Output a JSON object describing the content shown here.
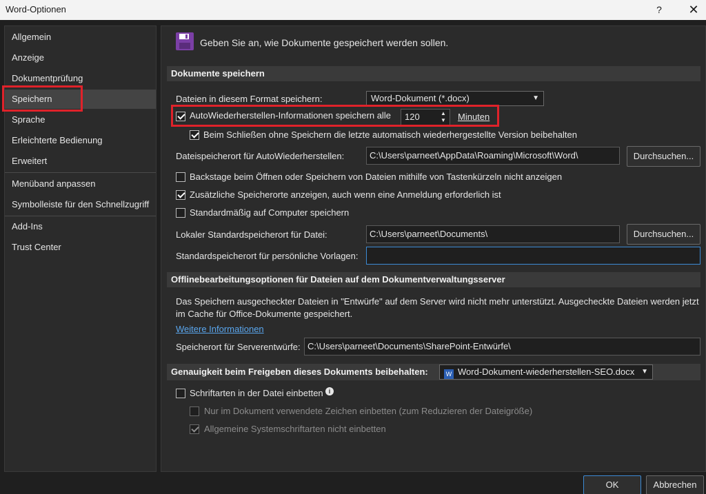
{
  "window": {
    "title": "Word-Optionen",
    "help": "?",
    "close": "✕"
  },
  "sidebar": {
    "items": [
      {
        "label": "Allgemein"
      },
      {
        "label": "Anzeige"
      },
      {
        "label": "Dokumentprüfung"
      },
      {
        "label": "Speichern",
        "selected": true
      },
      {
        "label": "Sprache"
      },
      {
        "label": "Erleichterte Bedienung"
      },
      {
        "label": "Erweitert"
      },
      {
        "label": "Menüband anpassen"
      },
      {
        "label": "Symbolleiste für den Schnellzugriff"
      },
      {
        "label": "Add-Ins"
      },
      {
        "label": "Trust Center"
      }
    ]
  },
  "header": {
    "text": "Geben Sie an, wie Dokumente gespeichert werden sollen."
  },
  "save_section": {
    "title": "Dokumente speichern",
    "format_label": "Dateien in diesem Format speichern:",
    "format_value": "Word-Dokument (*.docx)",
    "autorecover_label": "AutoWiederherstellen-Informationen speichern alle",
    "autorecover_checked": true,
    "autorecover_minutes": "120",
    "minutes_label": "Minuten",
    "keep_last_label": "Beim Schließen ohne Speichern die letzte automatisch wiederhergestellte Version beibehalten",
    "keep_last_checked": true,
    "autorecover_path_label": "Dateispeicherort für AutoWiederherstellen:",
    "autorecover_path": "C:\\Users\\parneet\\AppData\\Roaming\\Microsoft\\Word\\",
    "browse_label": "Durchsuchen...",
    "backstage_label": "Backstage beim Öffnen oder Speichern von Dateien mithilfe von Tastenkürzeln nicht anzeigen",
    "backstage_checked": false,
    "extra_locations_label": "Zusätzliche Speicherorte anzeigen, auch wenn eine Anmeldung erforderlich ist",
    "extra_locations_checked": true,
    "default_computer_label": "Standardmäßig auf Computer speichern",
    "default_computer_checked": false,
    "local_default_label": "Lokaler Standardspeicherort für Datei:",
    "local_default_path": "C:\\Users\\parneet\\Documents\\",
    "templates_label": "Standardspeicherort für persönliche Vorlagen:",
    "templates_path": ""
  },
  "offline_section": {
    "title": "Offlinebearbeitungsoptionen für Dateien auf dem Dokumentverwaltungsserver",
    "info_line1": "Das Speichern ausgecheckter Dateien in \"Entwürfe\" auf dem Server wird nicht mehr unterstützt. Ausgecheckte Dateien werden jetzt",
    "info_line2": "im Cache für Office-Dokumente gespeichert.",
    "more_info_link": "Weitere Informationen",
    "server_drafts_label": "Speicherort für Serverentwürfe:",
    "server_drafts_path": "C:\\Users\\parneet\\Documents\\SharePoint-Entwürfe\\"
  },
  "fidelity_section": {
    "title": "Genauigkeit beim Freigeben dieses Dokuments beibehalten:",
    "document": "Word-Dokument-wiederherstellen-SEO.docx",
    "embed_fonts_label": "Schriftarten in der Datei einbetten",
    "embed_fonts_checked": false,
    "only_used_chars_label": "Nur im Dokument verwendete Zeichen einbetten (zum Reduzieren der Dateigröße)",
    "only_used_chars_checked": false,
    "no_system_fonts_label": "Allgemeine Systemschriftarten nicht einbetten",
    "no_system_fonts_checked": true
  },
  "footer": {
    "ok": "OK",
    "cancel": "Abbrechen"
  },
  "colors": {
    "highlight_red": "#e0222a",
    "accent_blue": "#3c8bd6",
    "link_blue": "#5aa7ef",
    "save_icon_purple": "#7b3fa6"
  }
}
